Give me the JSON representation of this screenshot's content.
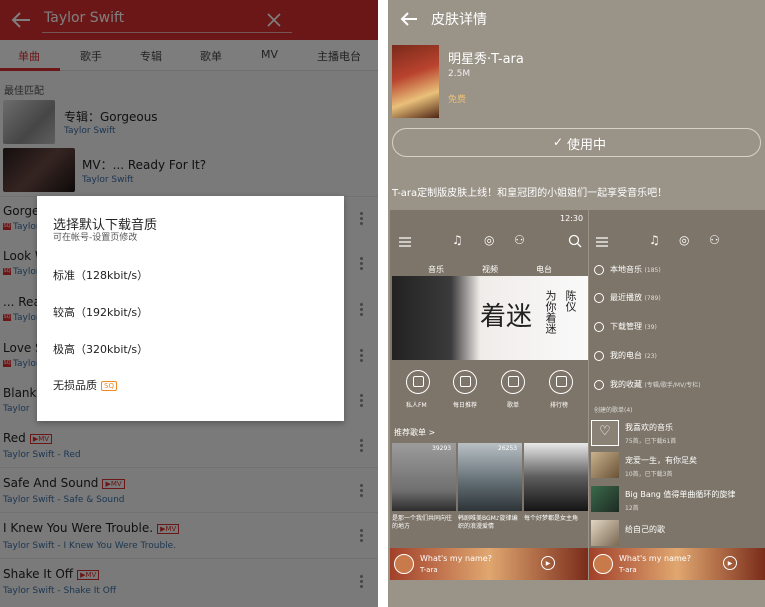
{
  "left": {
    "query": "Taylor Swift",
    "tabs": [
      "单曲",
      "歌手",
      "专辑",
      "歌单",
      "MV",
      "主播电台"
    ],
    "best_match_label": "最佳匹配",
    "best": [
      {
        "title": "专辑：Gorgeous",
        "sub": "Taylor Swift"
      },
      {
        "title": "MV：... Ready For It?",
        "sub": "Taylor Swift"
      }
    ],
    "rows": [
      {
        "title": "Gorge",
        "sub": "Taylor"
      },
      {
        "title": "Look W",
        "sub": "Taylor"
      },
      {
        "title": "... Rea",
        "sub": "Taylor"
      },
      {
        "title": "Love S",
        "sub": "Taylor"
      },
      {
        "title": "Blank",
        "sub": "Taylor"
      },
      {
        "title": "Red",
        "badge": "MV",
        "sub": "Taylor Swift - Red"
      },
      {
        "title": "Safe And Sound",
        "badge": "MV",
        "sub": "Taylor Swift - Safe & Sound"
      },
      {
        "title": "I Knew You Were Trouble.",
        "badge": "MV",
        "sub": "Taylor Swift - I Knew You Were Trouble."
      },
      {
        "title": "Shake It Off",
        "badge": "MV",
        "sub": "Taylor Swift - Shake It Off"
      }
    ],
    "dialog": {
      "title": "选择默认下载音质",
      "subtitle": "可在帐号-设置页修改",
      "options": [
        "标准（128kbit/s）",
        "较高（192kbit/s）",
        "极高（320kbit/s）",
        "无损品质"
      ],
      "lossless_badge": "SQ"
    }
  },
  "right": {
    "title": "皮肤详情",
    "skin_name": "明星秀·T-ara",
    "size": "2.5M",
    "price": "免费",
    "use_button": "使用中",
    "check": "✓",
    "description": "T-ara定制版皮肤上线！和皇冠团的小姐姐们一起享受音乐吧！",
    "phone1": {
      "time": "12:30",
      "tabs": [
        "音乐",
        "视频",
        "电台"
      ],
      "banner_big": "着迷",
      "banner_side": "为你着迷",
      "banner_side2": "陈仪",
      "shortcuts": [
        "私人FM",
        "每日推荐",
        "歌单",
        "排行榜"
      ],
      "section": "推荐歌单 >",
      "playlists": [
        {
          "plays": "39293",
          "cap": "是那一个我们共同向往的地方"
        },
        {
          "plays": "26253",
          "cap": "韩剧唯美BGM♪旋律编织的浪漫爱情"
        },
        {
          "plays": "",
          "cap": "每个好梦都是女主角"
        }
      ],
      "now_title": "What's my name?",
      "now_artist": "T-ara"
    },
    "phone2": {
      "menu": [
        {
          "label": "本地音乐",
          "count": "(185)"
        },
        {
          "label": "最近播放",
          "count": "(789)"
        },
        {
          "label": "下载管理",
          "count": "(39)"
        },
        {
          "label": "我的电台",
          "count": "(23)"
        },
        {
          "label": "我的收藏",
          "count": "(专辑/歌手/MV/专栏)"
        }
      ],
      "created_label": "创建的歌单(4)",
      "songs": [
        {
          "title": "我喜欢的音乐",
          "sub": "75首，已下载61首"
        },
        {
          "title": "宠爱一生，有你足矣",
          "sub": "10首，已下载3首"
        },
        {
          "title": "Big Bang 值得单曲循环的旋律",
          "sub": "12首"
        },
        {
          "title": "给自己的歌",
          "sub": ""
        }
      ],
      "now_title": "What's my name?",
      "now_artist": "T-ara"
    }
  }
}
